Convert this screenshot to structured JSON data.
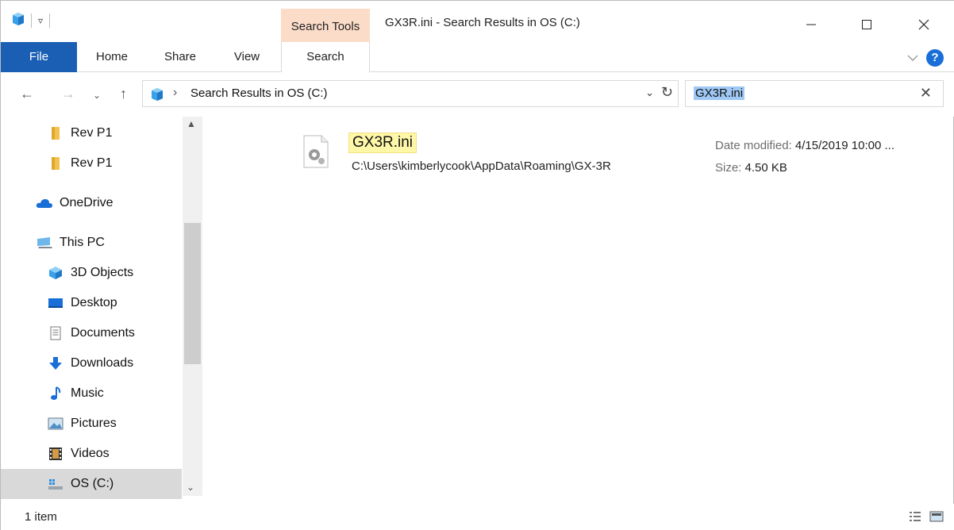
{
  "window": {
    "title": "GX3R.ini - Search Results in OS (C:)",
    "contextual_tab_group": "Search Tools"
  },
  "ribbon": {
    "tabs": [
      {
        "label": "File"
      },
      {
        "label": "Home"
      },
      {
        "label": "Share"
      },
      {
        "label": "View"
      },
      {
        "label": "Search"
      }
    ],
    "help_label": "?"
  },
  "address": {
    "path": "Search Results in OS (C:)"
  },
  "search": {
    "value": "GX3R.ini"
  },
  "nav_pane": {
    "items": [
      {
        "label": "Rev P1",
        "icon": "folder-icon"
      },
      {
        "label": "Rev P1",
        "icon": "folder-icon"
      },
      {
        "label": "OneDrive",
        "icon": "cloud-icon"
      },
      {
        "label": "This PC",
        "icon": "computer-icon"
      },
      {
        "label": "3D Objects",
        "icon": "cube-icon"
      },
      {
        "label": "Desktop",
        "icon": "desktop-icon"
      },
      {
        "label": "Documents",
        "icon": "document-icon"
      },
      {
        "label": "Downloads",
        "icon": "download-arrow-icon"
      },
      {
        "label": "Music",
        "icon": "music-note-icon"
      },
      {
        "label": "Pictures",
        "icon": "pictures-icon"
      },
      {
        "label": "Videos",
        "icon": "film-icon"
      },
      {
        "label": "OS (C:)",
        "icon": "drive-icon"
      }
    ],
    "selected": "OS (C:)"
  },
  "results": [
    {
      "name": "GX3R.ini",
      "path": "C:\\Users\\kimberlycook\\AppData\\Roaming\\GX-3R",
      "date_label": "Date modified:",
      "date_value": "4/15/2019 10:00 ...",
      "size_label": "Size:",
      "size_value": "4.50 KB"
    }
  ],
  "status": {
    "item_count": "1 item"
  },
  "colors": {
    "file_tab": "#1a5fb4",
    "contextual_tab": "#fbdcc9",
    "highlight": "#fff7a8",
    "selection": "#9fc8f5"
  }
}
